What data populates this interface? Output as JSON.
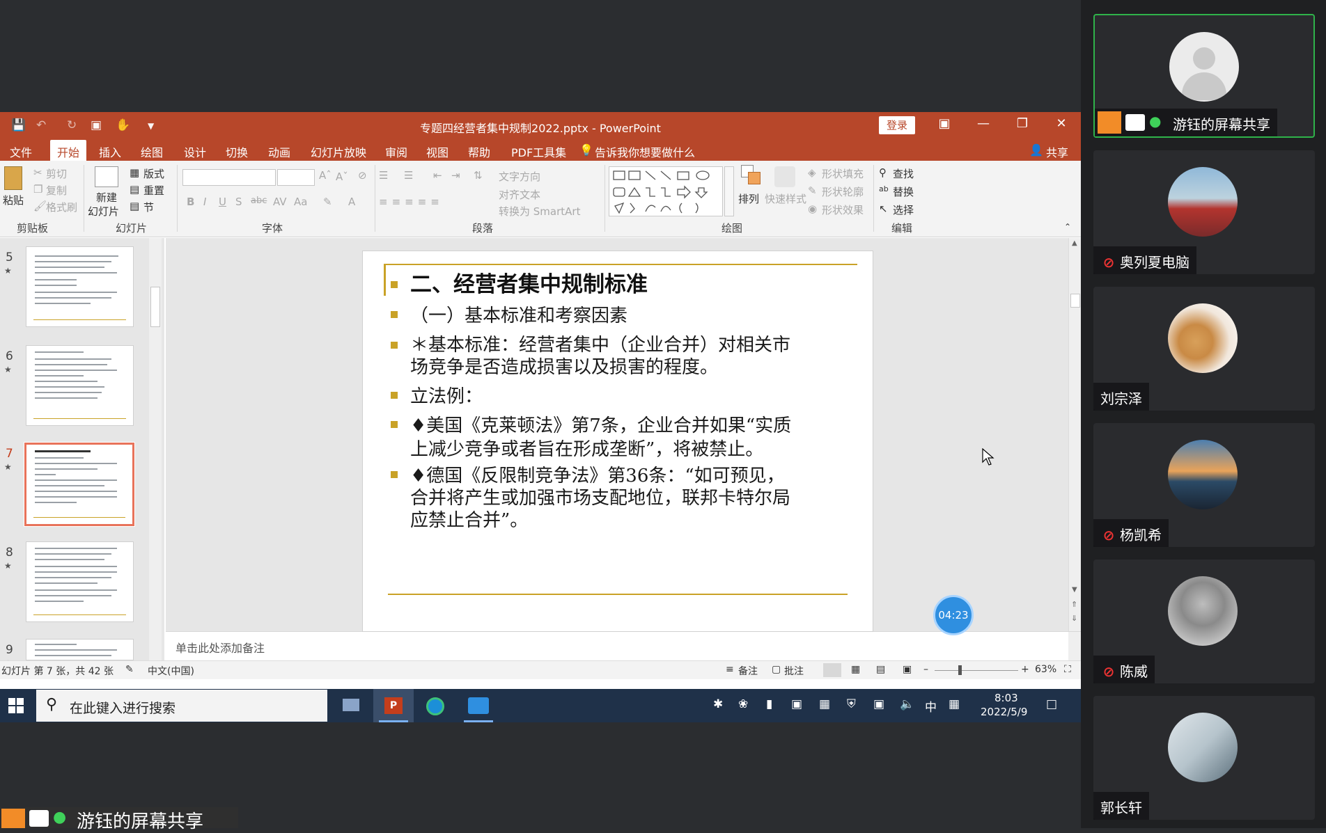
{
  "window": {
    "title": "专题四经营者集中规制2022.pptx  -  PowerPoint",
    "login_label": "登录"
  },
  "menu": {
    "tabs": [
      "文件",
      "开始",
      "插入",
      "绘图",
      "设计",
      "切换",
      "动画",
      "幻灯片放映",
      "审阅",
      "视图",
      "帮助",
      "PDF工具集"
    ],
    "tellme": "告诉我你想要做什么",
    "share": "共享"
  },
  "ribbon": {
    "clipboard": {
      "paste": "粘贴",
      "cut": "剪切",
      "copy": "复制",
      "format_painter": "格式刷",
      "label": "剪贴板"
    },
    "slides": {
      "new_slide": "新建",
      "new_slide2": "幻灯片",
      "layout": "版式",
      "reset": "重置",
      "section": "节",
      "label": "幻灯片"
    },
    "font": {
      "label": "字体",
      "bold": "B",
      "italic": "I",
      "underline": "U",
      "strike": "S",
      "spacing": "abc"
    },
    "paragraph": {
      "label": "段落",
      "text_direction": "文字方向",
      "align_text": "对齐文本",
      "smartart": "转换为 SmartArt"
    },
    "drawing": {
      "label": "绘图",
      "arrange": "排列",
      "quick_styles": "快速样式",
      "shape_fill": "形状填充",
      "shape_outline": "形状轮廓",
      "shape_effects": "形状效果"
    },
    "editing": {
      "label": "编辑",
      "find": "查找",
      "replace": "替换",
      "select": "选择"
    }
  },
  "thumbnails": [
    {
      "num": "5",
      "star": "★"
    },
    {
      "num": "6",
      "star": "★"
    },
    {
      "num": "7",
      "star": "★"
    },
    {
      "num": "8",
      "star": "★"
    },
    {
      "num": "9",
      "star": "★"
    }
  ],
  "slide": {
    "title": "二、经营者集中规制标准",
    "lines": [
      "（一）基本标准和考察因素",
      "＊基本标准：经营者集中（企业合并）对相关市",
      "场竞争是否造成损害以及损害的程度。",
      "立法例：",
      "♦美国《克莱顿法》第7条，企业合并如果“实质",
      "上减少竞争或者旨在形成垄断”，将被禁止。",
      "♦德国《反限制竞争法》第36条：“如可预见，",
      "合并将产生或加强市场支配地位，联邦卡特尔局",
      "应禁止合并”。"
    ]
  },
  "timer": "04:23",
  "notes_placeholder": "单击此处添加备注",
  "status": {
    "slide_info": "幻灯片 第 7 张，共 42 张",
    "language": "中文(中国)",
    "notes": "备注",
    "comments": "批注",
    "zoom": "63%"
  },
  "taskbar": {
    "search_placeholder": "在此键入进行搜索",
    "ime": "中",
    "time": "8:03",
    "date": "2022/5/9"
  },
  "share_label": "游钰的屏幕共享",
  "participants": [
    {
      "name": "游钰的屏幕共享",
      "muted": false,
      "active": true
    },
    {
      "name": "奥列夏电脑",
      "muted": true,
      "active": false
    },
    {
      "name": "刘宗泽",
      "muted": false,
      "active": false
    },
    {
      "name": "杨凯希",
      "muted": true,
      "active": false
    },
    {
      "name": "陈威",
      "muted": true,
      "active": false
    },
    {
      "name": "郭长轩",
      "muted": false,
      "active": false
    }
  ],
  "colors": {
    "ppt_red": "#b7472a",
    "gold": "#c9a227",
    "active_border": "#2fb34a"
  }
}
